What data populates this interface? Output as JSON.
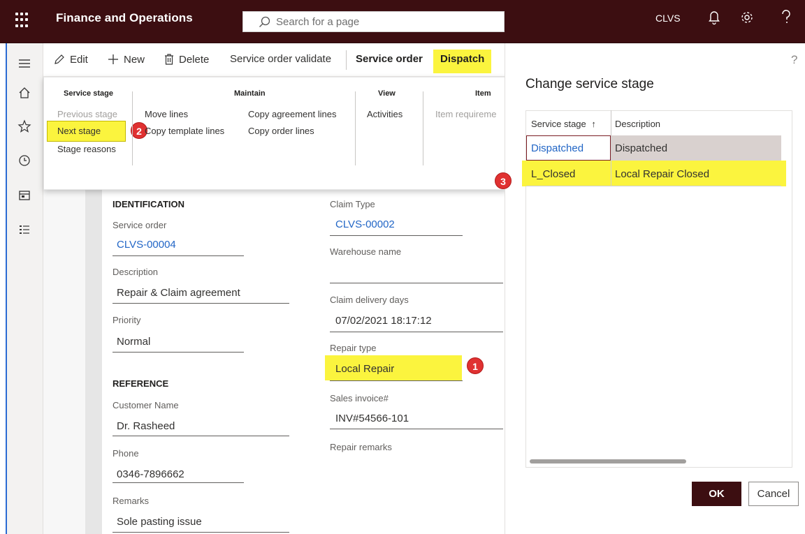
{
  "app": {
    "title": "Finance and Operations",
    "search_placeholder": "Search for a page",
    "company": "CLVS",
    "bar_color": "#3c0e11"
  },
  "action_pane": {
    "edit": "Edit",
    "new": "New",
    "delete": "Delete",
    "validate": "Service order validate",
    "tab_service_order": "Service order",
    "tab_dispatch": "Dispatch"
  },
  "ribbon": {
    "groups": {
      "service_stage": "Service stage",
      "maintain": "Maintain",
      "view": "View",
      "item": "Item"
    },
    "items": {
      "previous_stage": "Previous stage",
      "next_stage": "Next stage",
      "stage_reasons": "Stage reasons",
      "move_lines": "Move lines",
      "copy_template_lines": "Copy template lines",
      "copy_agreement_lines": "Copy agreement lines",
      "copy_order_lines": "Copy order lines",
      "activities": "Activities",
      "item_requirements": "Item requireme"
    }
  },
  "form": {
    "identification_title": "IDENTIFICATION",
    "reference_title": "REFERENCE",
    "service_order_label": "Service order",
    "service_order_value": "CLVS-00004",
    "description_label": "Description",
    "description_value": "Repair & Claim agreement",
    "priority_label": "Priority",
    "priority_value": "Normal",
    "customer_name_label": "Customer Name",
    "customer_name_value": "Dr. Rasheed",
    "phone_label": "Phone",
    "phone_value": "0346-7896662",
    "remarks_label": "Remarks",
    "remarks_value": "Sole pasting issue",
    "claim_type_label": "Claim Type",
    "claim_type_value": "CLVS-00002",
    "warehouse_label": "Warehouse name",
    "warehouse_value": "",
    "claim_delivery_label": "Claim delivery days",
    "claim_delivery_value": "07/02/2021 18:17:12",
    "repair_type_label": "Repair type",
    "repair_type_value": "Local Repair",
    "sales_invoice_label": "Sales invoice#",
    "sales_invoice_value": "INV#54566-101",
    "repair_remarks_label": "Repair remarks"
  },
  "badges": [
    "1",
    "2",
    "3"
  ],
  "dialog": {
    "title": "Change service stage",
    "help": "?",
    "col_stage": "Service stage",
    "col_stage_sort": "↑",
    "col_description": "Description",
    "rows": [
      {
        "stage": "Dispatched",
        "description": "Dispatched"
      },
      {
        "stage": "L_Closed",
        "description": "Local Repair Closed"
      }
    ],
    "ok": "OK",
    "cancel": "Cancel"
  },
  "highlight_color": "#fbf43e",
  "icons": [
    "waffle-icon",
    "search-icon",
    "bell-icon",
    "gear-icon",
    "help-icon",
    "hamburger-icon",
    "home-icon",
    "star-icon",
    "clock-icon",
    "workspace-icon",
    "list-icon",
    "edit-icon",
    "plus-icon",
    "trash-icon"
  ]
}
